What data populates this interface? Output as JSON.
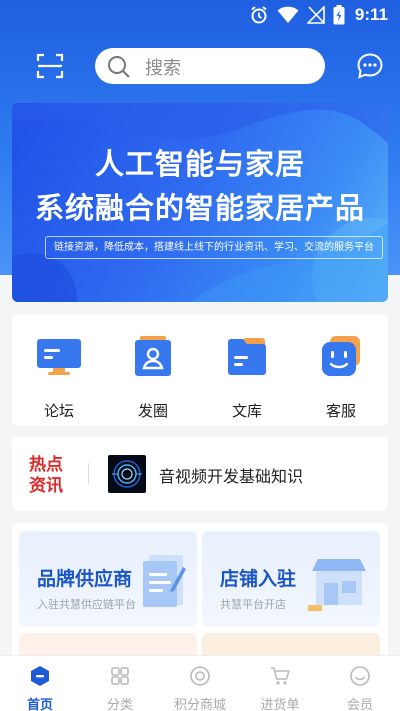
{
  "status_bar": {
    "time": "9:11"
  },
  "search": {
    "placeholder": "搜索"
  },
  "banner": {
    "line1": "人工智能与家居",
    "line2": "系统融合的智能家居产品",
    "subtitle": "链接资源，降低成本，搭建线上线下的行业资讯、学习、交流的服务平台"
  },
  "quick_menu": [
    {
      "label": "论坛",
      "icon": "monitor-icon"
    },
    {
      "label": "发圈",
      "icon": "person-card-icon"
    },
    {
      "label": "文库",
      "icon": "folder-icon"
    },
    {
      "label": "客服",
      "icon": "robot-face-icon"
    }
  ],
  "news": {
    "tag_line1": "热点",
    "tag_line2": "资讯",
    "title": "音视频开发基础知识"
  },
  "services": [
    {
      "title": "品牌供应商",
      "subtitle": "入驻共慧供应链平台"
    },
    {
      "title": "店铺入驻",
      "subtitle": "共慧平台开店"
    }
  ],
  "tabbar": [
    {
      "label": "首页",
      "active": true
    },
    {
      "label": "分类"
    },
    {
      "label": "积分商城"
    },
    {
      "label": "进货单"
    },
    {
      "label": "会员"
    }
  ],
  "colors": {
    "primary": "#1e5bd8",
    "hot": "#d82d2d"
  }
}
